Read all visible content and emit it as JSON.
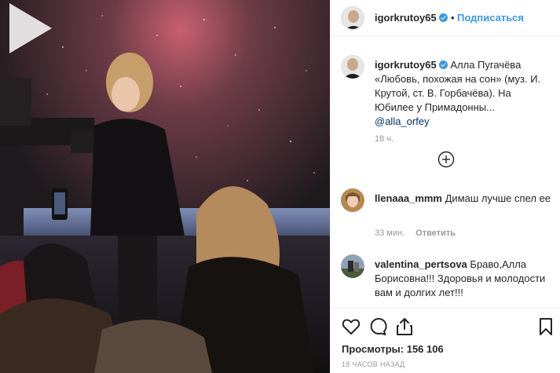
{
  "post": {
    "author": "igorkrutoy65",
    "dot": "•",
    "follow_label": "Подписаться",
    "views_label": "Просмотры:",
    "views_count": "156 106",
    "time_ago": "18 ЧАСОВ НАЗАД"
  },
  "caption": {
    "username": "igorkrutoy65",
    "text": "Алла Пугачёва «Любовь, похожая на сон» (муз. И. Крутой, ст. В. Горбачёва). На Юбилее у Примадонны...",
    "mention": "@alla_orfey",
    "time": "18 ч."
  },
  "comments": [
    {
      "username": "llenaaa_mmm",
      "text": "Димаш лучше спел ее",
      "time": "33 мин.",
      "reply_label": "Ответить"
    },
    {
      "username": "valentina_pertsova",
      "text": "Браво,Алла Борисовна!!! Здоровья и молодости вам и долгих лет!!!"
    }
  ],
  "icons": {
    "play": "play-icon",
    "load_more": "plus-circle-icon",
    "like": "heart-icon",
    "comment": "comment-icon",
    "share": "share-icon",
    "save": "bookmark-icon"
  },
  "colors": {
    "accent": "#3897f0",
    "text": "#262626",
    "secondary": "#999999",
    "mention": "#003569"
  }
}
